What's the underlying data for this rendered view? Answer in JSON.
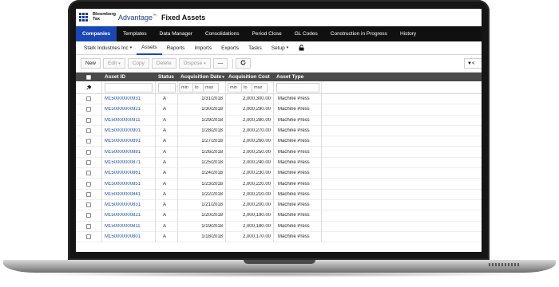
{
  "header": {
    "brand_line1": "Bloomberg",
    "brand_line2": "Tax",
    "product": "Advantage",
    "product_mark": "™",
    "module": "Fixed Assets"
  },
  "main_nav": [
    "Companies",
    "Templates",
    "Data Manager",
    "Consolidations",
    "Period Close",
    "GL Codes",
    "Construction in Progress",
    "History"
  ],
  "sub_nav": {
    "company": "Stark Industries Inc",
    "tabs": [
      "Assets",
      "Reports",
      "Imports",
      "Exports",
      "Tasks"
    ],
    "setup": "Setup"
  },
  "toolbar": {
    "new": "New",
    "edit": "Edit",
    "copy": "Copy",
    "delete": "Delete",
    "dispose": "Dispose",
    "more": "—",
    "filter_text": "▼<"
  },
  "grid": {
    "columns": {
      "asset_id": "Asset ID",
      "status": "Status",
      "acq_date": "Acquisition Date",
      "acq_cost": "Acquisition Cost",
      "asset_type": "Asset Type"
    },
    "filter": {
      "min": "min",
      "to": "to",
      "max": "max"
    },
    "rows": [
      {
        "id": "M150000000931",
        "status": "A",
        "date": "1/31/2018",
        "cost": "2,000,300.00",
        "type": "Machine Press"
      },
      {
        "id": "M150000000921",
        "status": "A",
        "date": "1/30/2018",
        "cost": "2,000,290.00",
        "type": "Machine Press"
      },
      {
        "id": "M150000000911",
        "status": "A",
        "date": "1/29/2018",
        "cost": "2,000,280.00",
        "type": "Machine Press"
      },
      {
        "id": "M150000000901",
        "status": "A",
        "date": "1/28/2018",
        "cost": "2,000,270.00",
        "type": "Machine Press"
      },
      {
        "id": "M150000000891",
        "status": "A",
        "date": "1/27/2018",
        "cost": "2,000,260.00",
        "type": "Machine Press"
      },
      {
        "id": "M150000000881",
        "status": "A",
        "date": "1/26/2018",
        "cost": "2,000,250.00",
        "type": "Machine Press"
      },
      {
        "id": "M150000000871",
        "status": "A",
        "date": "1/25/2018",
        "cost": "2,000,240.00",
        "type": "Machine Press"
      },
      {
        "id": "M150000000861",
        "status": "A",
        "date": "1/24/2018",
        "cost": "2,000,230.00",
        "type": "Machine Press"
      },
      {
        "id": "M150000000851",
        "status": "A",
        "date": "1/23/2018",
        "cost": "2,000,220.00",
        "type": "Machine Press"
      },
      {
        "id": "M150000000841",
        "status": "A",
        "date": "1/22/2018",
        "cost": "2,000,210.00",
        "type": "Machine Press"
      },
      {
        "id": "M150000000831",
        "status": "A",
        "date": "1/21/2018",
        "cost": "2,000,200.00",
        "type": "Machine Press"
      },
      {
        "id": "M150000000821",
        "status": "A",
        "date": "1/20/2018",
        "cost": "2,000,190.00",
        "type": "Machine Press"
      },
      {
        "id": "M150000000811",
        "status": "A",
        "date": "1/19/2018",
        "cost": "2,000,180.00",
        "type": "Machine Press"
      },
      {
        "id": "M150000000801",
        "status": "A",
        "date": "1/18/2018",
        "cost": "2,000,170.00",
        "type": "Machine Press"
      }
    ]
  },
  "colors": {
    "accent": "#1a47b4",
    "nav_bg": "#101010",
    "link": "#1f4ea8",
    "grid_header": "#4a4a4a"
  },
  "icons": [
    "apps-grid-icon",
    "lock-icon",
    "refresh-icon",
    "pin-icon",
    "filter-icon"
  ]
}
